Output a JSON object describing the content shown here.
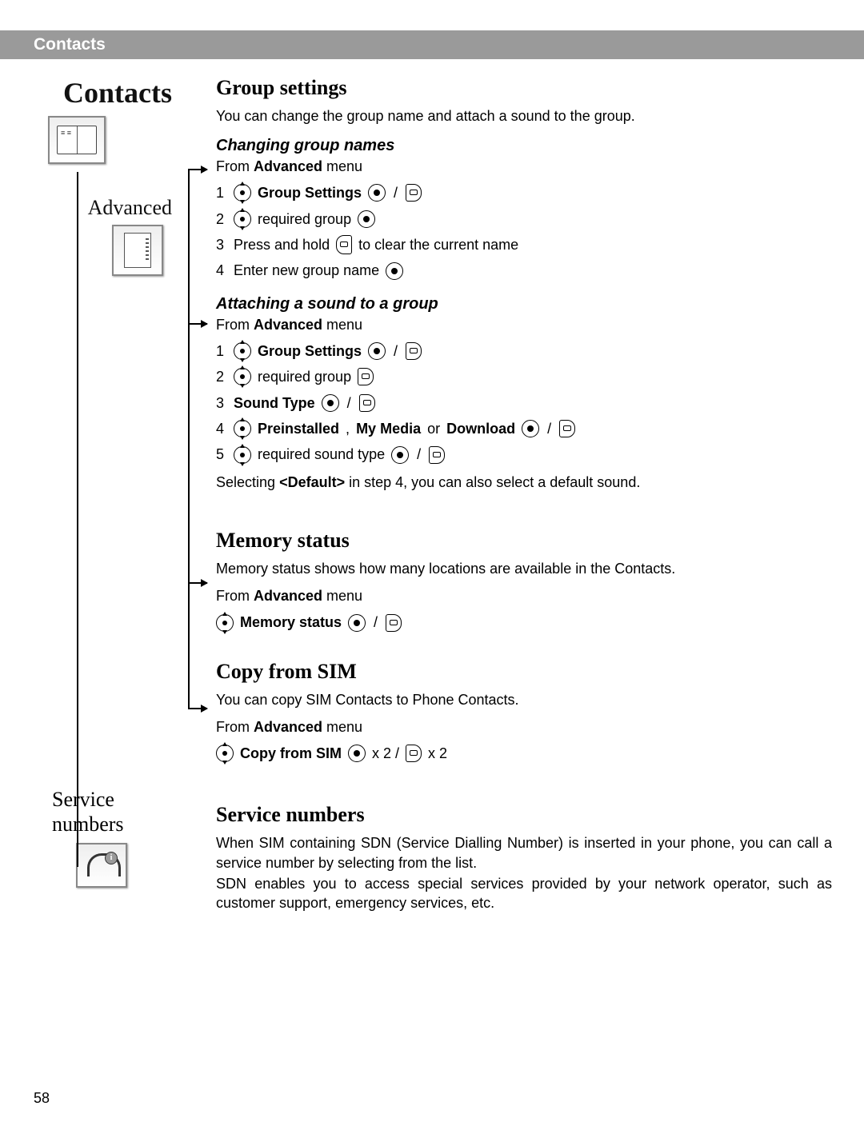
{
  "header": {
    "title": "Contacts"
  },
  "sidebar": {
    "contacts_title": "Contacts",
    "advanced_title": "Advanced",
    "service_title": "Service numbers"
  },
  "sections": {
    "group_settings": {
      "heading": "Group settings",
      "intro": "You can change the group name and attach a sound to the group.",
      "changing_names": {
        "subheading": "Changing group names",
        "from_prefix": "From ",
        "from_bold": "Advanced",
        "from_suffix": " menu",
        "steps": {
          "s1_bold": "Group Settings",
          "s2_text": "required group",
          "s3_a": "Press and hold ",
          "s3_b": " to clear the current name",
          "s4_text": "Enter new group name"
        }
      },
      "attaching_sound": {
        "subheading": "Attaching a sound to a group",
        "from_prefix": "From ",
        "from_bold": "Advanced",
        "from_suffix": " menu",
        "steps": {
          "s1_bold": "Group Settings",
          "s2_text": "required group",
          "s3_bold": "Sound Type",
          "s4_bold_a": "Preinstalled",
          "s4_sep1": ", ",
          "s4_bold_b": "My Media",
          "s4_mid": " or ",
          "s4_bold_c": "Download",
          "s5_text": "required sound type"
        },
        "note_a": "Selecting ",
        "note_bold": "<Default>",
        "note_b": " in step 4, you can also select a default sound."
      }
    },
    "memory_status": {
      "heading": "Memory status",
      "intro": "Memory status shows how many locations are available in the Contacts.",
      "from_prefix": "From ",
      "from_bold": "Advanced",
      "from_suffix": " menu",
      "label_bold": "Memory status"
    },
    "copy_from_sim": {
      "heading": "Copy from SIM",
      "intro": "You can copy SIM Contacts to Phone Contacts.",
      "from_prefix": "From ",
      "from_bold": "Advanced",
      "from_suffix": " menu",
      "label_bold": "Copy from SIM",
      "suffix1": " x 2 / ",
      "suffix2": " x 2"
    },
    "service_numbers": {
      "heading": "Service numbers",
      "para1": "When SIM containing SDN (Service Dialling Number) is inserted in your phone, you can call a service number by selecting from the list.",
      "para2": "SDN enables you to access special services provided by your network operator, such as customer support, emergency services, etc."
    }
  },
  "page_number": "58"
}
